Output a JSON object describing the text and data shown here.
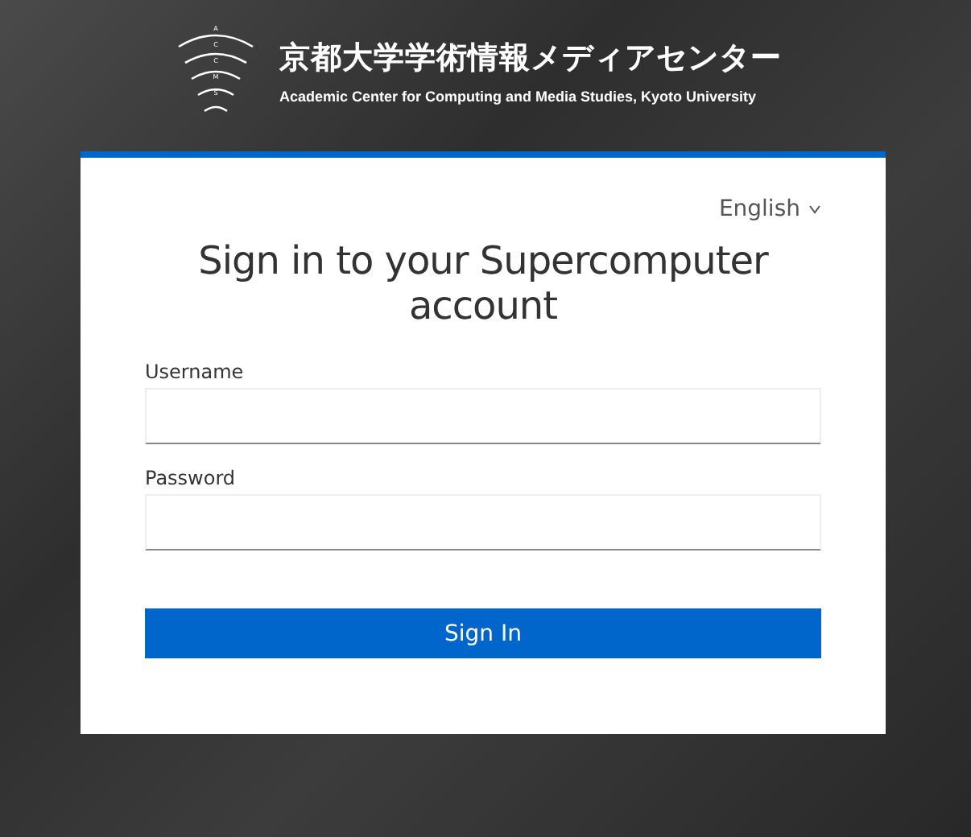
{
  "header": {
    "logo_letters": [
      "A",
      "C",
      "C",
      "M",
      "S"
    ],
    "title": "京都大学学術情報メディアセンター",
    "subtitle": "Academic Center for Computing and Media Studies, Kyoto University"
  },
  "card": {
    "language": "English",
    "title": "Sign in to your Supercomputer account",
    "fields": [
      {
        "label": "Username"
      },
      {
        "label": "Password"
      }
    ],
    "button": "Sign In"
  }
}
